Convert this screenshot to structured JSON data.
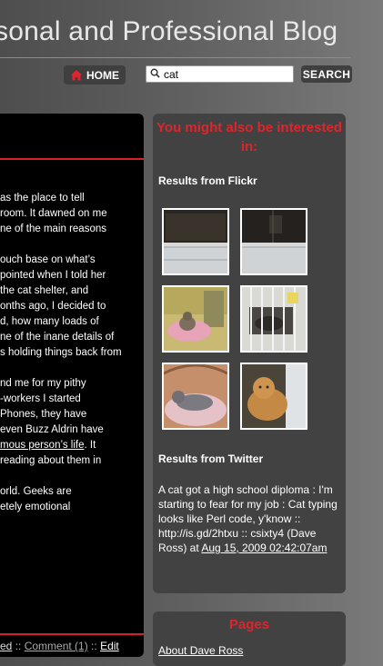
{
  "header": {
    "title": "sonal and Professional Blog",
    "home_label": "HOME",
    "search_value": "cat",
    "search_button": "SEARCH"
  },
  "post": {
    "lines": [
      [
        "as the place to tell",
        "room. It dawned on me",
        "ne of the main reasons"
      ],
      [
        "ouch base on what’s",
        "pointed when I told her",
        "the cat shelter, and",
        "onths ago, I decided to",
        "d, how many loads of",
        "ne of the inane details of",
        "s holding things back from"
      ],
      [
        "nd me for my pithy",
        "-workers I started",
        "Phones, they have",
        " even Buzz Aldrin have"
      ],
      [
        "orld. Geeks are",
        "etely emotional"
      ]
    ],
    "link_text": "mous person’s life",
    "link_after": ". It",
    "line_after_link": "reading about them in",
    "footer": {
      "category_fragment": "ed",
      "sep1": " :: ",
      "comment": "Comment (1)",
      "sep2": " :: ",
      "edit": "Edit"
    }
  },
  "sidebar": {
    "related_title": "You might also be interested in:",
    "flickr_label": "Results from Flickr",
    "twitter_label": "Results from Twitter",
    "tweet_text": "A cat got a high school diploma : I'm starting to fear for my job : Cat typing looks like Perl code, y'know :: http://is.gd/2htxu :: csixty4 (Dave Ross) at ",
    "tweet_date": "Aug 15, 2009 02:42:07am",
    "pages_title": "Pages",
    "pages_link": "About Dave Ross"
  },
  "colors": {
    "accent_red": "#e0242b",
    "panel": "#424242",
    "post_bg": "#000000"
  },
  "icons": [
    "home-icon",
    "search-icon"
  ]
}
